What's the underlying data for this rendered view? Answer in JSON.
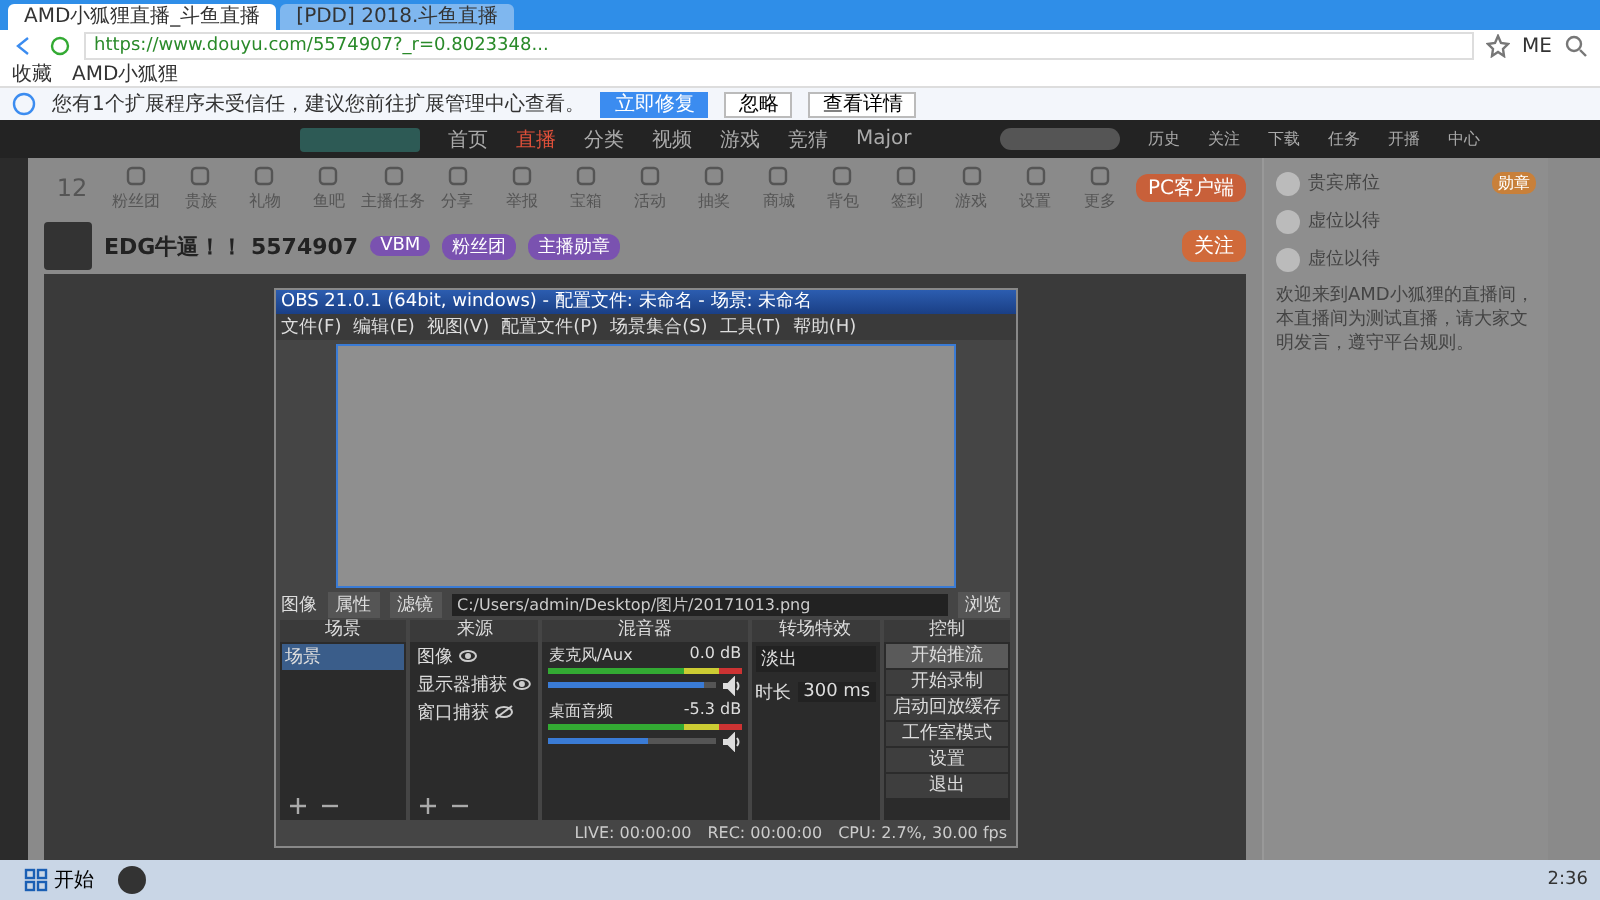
{
  "browser": {
    "tabs": [
      {
        "label": "AMD小狐狸直播_斗鱼直播",
        "selected": true
      },
      {
        "label": "[PDD] 2018.斗鱼直播",
        "selected": false
      }
    ],
    "url": "https://www.douyu.com/5574907?_r=0.8023348...",
    "bookmarks": [
      "收藏",
      "AMD小狐狸"
    ],
    "user": "ME",
    "notice": {
      "text": "您有1个扩展程序未受信任，建议您前往扩展管理中心查看。",
      "buttons": [
        {
          "label": "立即修复",
          "primary": true
        },
        {
          "label": "忽略",
          "primary": false
        },
        {
          "label": "查看详情",
          "primary": false
        }
      ]
    }
  },
  "site": {
    "nav": [
      {
        "label": "首页",
        "selected": false
      },
      {
        "label": "直播",
        "selected": true
      },
      {
        "label": "分类",
        "selected": false
      },
      {
        "label": "视频",
        "selected": false
      },
      {
        "label": "游戏",
        "selected": false
      },
      {
        "label": "竞猜",
        "selected": false
      },
      {
        "label": "Major",
        "selected": false
      }
    ],
    "actions": [
      "历史",
      "关注",
      "下载",
      "任务",
      "开播",
      "中心"
    ]
  },
  "toolbar": {
    "rank": "12",
    "items": [
      "粉丝团",
      "贵族",
      "礼物",
      "鱼吧",
      "主播任务",
      "分享",
      "举报",
      "宝箱",
      "活动",
      "抽奖",
      "商城",
      "背包",
      "签到",
      "游戏",
      "设置",
      "更多"
    ],
    "client": "PC客户端"
  },
  "room": {
    "title": "EDG牛逼！！ 5574907",
    "tags": [
      "VBM",
      "粉丝团",
      "主播勋章"
    ],
    "follow": "关注",
    "ranks": [
      {
        "name": "贵宾席位",
        "badge": "勋章"
      },
      {
        "name": "虚位以待"
      },
      {
        "name": "虚位以待"
      }
    ],
    "description": "欢迎来到AMD小狐狸的直播间，本直播间为测试直播，请大家文明发言，遵守平台规则。"
  },
  "obs": {
    "title": "OBS 21.0.1 (64bit, windows) - 配置文件: 未命名 - 场景: 未命名",
    "menu": [
      "文件(F)",
      "编辑(E)",
      "视图(V)",
      "配置文件(P)",
      "场景集合(S)",
      "工具(T)",
      "帮助(H)"
    ],
    "source_bar": {
      "label": "图像",
      "properties": "属性",
      "filters": "滤镜",
      "button": "浏览"
    },
    "path": "C:/Users/admin/Desktop/图片/20171013.png",
    "scenes": {
      "title": "场景",
      "items": [
        {
          "label": "场景",
          "selected": true
        }
      ]
    },
    "sources": {
      "title": "来源",
      "items": [
        {
          "label": "图像",
          "visible": true
        },
        {
          "label": "显示器捕获",
          "visible": true
        },
        {
          "label": "窗口捕获",
          "visible": false
        }
      ]
    },
    "mixer": {
      "title": "混音器",
      "channels": [
        {
          "name": "麦克风/Aux",
          "reading": "0.0 dB",
          "level": 0.93,
          "muted": false
        },
        {
          "name": "桌面音频",
          "reading": "-5.3 dB",
          "level": 0.6,
          "muted": false
        }
      ]
    },
    "transitions": {
      "title": "转场特效",
      "effect": "淡出",
      "duration_label": "时长",
      "duration": "300 ms"
    },
    "controls": {
      "title": "控制",
      "buttons": [
        {
          "label": "开始推流",
          "selected": true
        },
        {
          "label": "开始录制",
          "selected": false
        },
        {
          "label": "启动回放缓存",
          "selected": false
        },
        {
          "label": "工作室模式",
          "selected": false
        },
        {
          "label": "设置",
          "selected": false
        },
        {
          "label": "退出",
          "selected": false
        }
      ]
    },
    "status": [
      "LIVE: 00:00:00",
      "REC: 00:00:00",
      "CPU: 2.7%, 30.00 fps"
    ]
  },
  "taskbar": {
    "start": "开始",
    "time": "2:36"
  }
}
